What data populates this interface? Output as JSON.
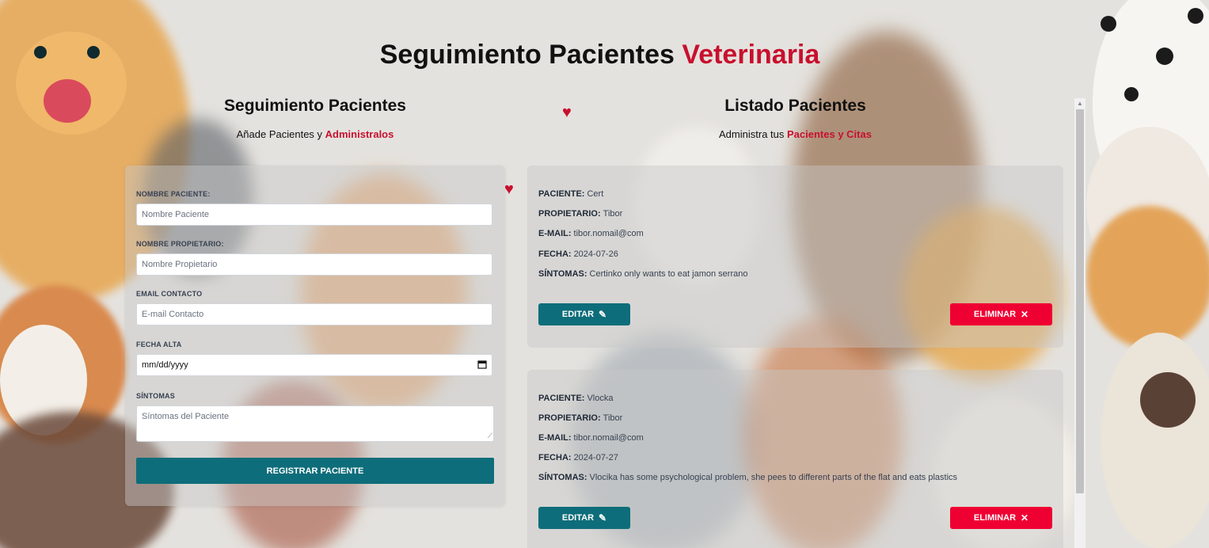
{
  "title": {
    "prefix": "Seguimiento Pacientes",
    "accent": "Veterinaria"
  },
  "form_section": {
    "title": "Seguimiento Pacientes",
    "subtitle_prefix": "Añade Pacientes y",
    "subtitle_accent": "Administralos"
  },
  "list_section": {
    "title": "Listado Pacientes",
    "subtitle_prefix": "Administra tus",
    "subtitle_accent": "Pacientes y Citas"
  },
  "form": {
    "patient_label": "Nombre Paciente:",
    "patient_placeholder": "Nombre Paciente",
    "owner_label": "Nombre Propietario:",
    "owner_placeholder": "Nombre Propietario",
    "email_label": "Email Contacto",
    "email_placeholder": "E-mail Contacto",
    "date_label": "Fecha Alta",
    "date_placeholder": "mm/dd/yyyy",
    "symptoms_label": "Síntomas",
    "symptoms_placeholder": "Síntomas del Paciente",
    "submit_label": "Registrar Paciente"
  },
  "card_labels": {
    "patient": "Paciente:",
    "owner": "Propietario:",
    "email": "E-mail:",
    "date": "Fecha:",
    "symptoms": "Síntomas:",
    "edit": "Editar",
    "delete": "Eliminar"
  },
  "patients": [
    {
      "name": "Cert",
      "owner": "Tibor",
      "email": "tibor.nomail@com",
      "date": "2024-07-26",
      "symptoms": "Certinko only wants to eat jamon serrano"
    },
    {
      "name": "Vlocka",
      "owner": "Tibor",
      "email": "tibor.nomail@com",
      "date": "2024-07-27",
      "symptoms": "Vlocika has some psychological problem, she pees to different parts of the flat and eats plastics"
    }
  ],
  "icons": {
    "edit": "pencil-icon",
    "delete": "x-mark-icon",
    "calendar": "calendar-icon"
  },
  "colors": {
    "accent": "#c8102e",
    "primary_button": "#0e6d7a",
    "danger_button": "#ef0033"
  }
}
